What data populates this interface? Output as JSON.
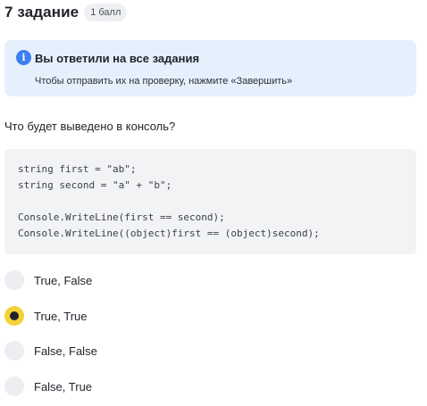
{
  "header": {
    "title": "7 задание",
    "badge": "1 балл"
  },
  "notice": {
    "icon": "info-icon",
    "title": "Вы ответили на все задания",
    "text": "Чтобы отправить их на проверку, нажмите «Завершить»"
  },
  "question": {
    "text": "Что будет выведено в консоль?",
    "code_lines": [
      "string first = \"ab\";",
      "string second = \"a\" + \"b\";",
      "",
      "Console.WriteLine(first == second);",
      "Console.WriteLine((object)first == (object)second);"
    ]
  },
  "options": [
    {
      "label": "True, False",
      "selected": false
    },
    {
      "label": "True, True",
      "selected": true
    },
    {
      "label": "False, False",
      "selected": false
    },
    {
      "label": "False, True",
      "selected": false
    }
  ],
  "colors": {
    "notice_bg": "#e6f0fd",
    "info_icon": "#3d7ef0",
    "selected_radio": "#f5d13a",
    "code_bg": "#f2f3f5"
  }
}
